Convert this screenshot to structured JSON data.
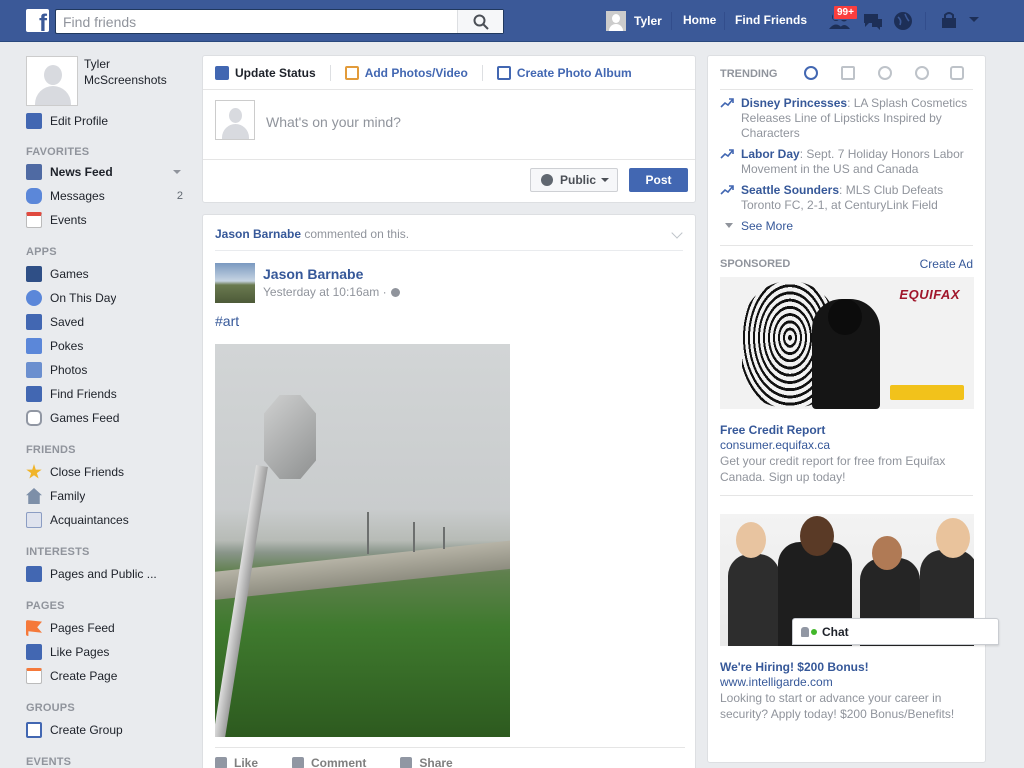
{
  "topbar": {
    "search_placeholder": "Find friends",
    "user_name": "Tyler",
    "home": "Home",
    "find_friends": "Find Friends",
    "friend_requests_badge": "99+",
    "brand_color": "#3b5998"
  },
  "sidebar": {
    "profile_name": "Tyler McScreenshots",
    "edit_profile": "Edit Profile",
    "sections": {
      "favorites": "FAVORITES",
      "apps": "APPS",
      "friends": "FRIENDS",
      "interests": "INTERESTS",
      "pages": "PAGES",
      "groups": "GROUPS",
      "events": "EVENTS"
    },
    "favorites": [
      {
        "label": "News Feed",
        "icon": "news-feed-icon",
        "count": ""
      },
      {
        "label": "Messages",
        "icon": "messages-icon",
        "count": "2"
      },
      {
        "label": "Events",
        "icon": "events-icon",
        "count": ""
      }
    ],
    "apps": [
      {
        "label": "Games",
        "icon": "games-icon"
      },
      {
        "label": "On This Day",
        "icon": "on-this-day-icon"
      },
      {
        "label": "Saved",
        "icon": "saved-icon"
      },
      {
        "label": "Pokes",
        "icon": "pokes-icon"
      },
      {
        "label": "Photos",
        "icon": "photos-icon"
      },
      {
        "label": "Find Friends",
        "icon": "find-friends-icon"
      },
      {
        "label": "Games Feed",
        "icon": "games-feed-icon"
      }
    ],
    "friends": [
      {
        "label": "Close Friends",
        "icon": "star-icon"
      },
      {
        "label": "Family",
        "icon": "family-icon"
      },
      {
        "label": "Acquaintances",
        "icon": "acquaintances-icon"
      }
    ],
    "interests": [
      {
        "label": "Pages and Public ...",
        "icon": "pages-public-icon"
      }
    ],
    "pages": [
      {
        "label": "Pages Feed",
        "icon": "flag-icon"
      },
      {
        "label": "Like Pages",
        "icon": "like-pages-icon"
      },
      {
        "label": "Create Page",
        "icon": "create-page-icon"
      }
    ],
    "groups": [
      {
        "label": "Create Group",
        "icon": "create-group-icon"
      }
    ]
  },
  "composer": {
    "tabs": [
      "Update Status",
      "Add Photos/Video",
      "Create Photo Album"
    ],
    "placeholder": "What's on your mind?",
    "privacy": "Public",
    "post_button": "Post"
  },
  "post": {
    "story_actor": "Jason Barnabe",
    "story_action": " commented on this.",
    "author": "Jason Barnabe",
    "time": "Yesterday at 10:16am ·",
    "text": "#art",
    "actions": [
      "Like",
      "Comment",
      "Share"
    ]
  },
  "trending": {
    "title": "TRENDING",
    "items": [
      {
        "topic": "Disney Princesses",
        "desc": ": LA Splash Cosmetics Releases Line of Lipsticks Inspired by Characters"
      },
      {
        "topic": "Labor Day",
        "desc": ": Sept. 7 Holiday Honors Labor Movement in the US and Canada"
      },
      {
        "topic": "Seattle Sounders",
        "desc": ": MLS Club Defeats Toronto FC, 2-1, at CenturyLink Field"
      }
    ],
    "see_more": "See More"
  },
  "sponsored": {
    "title": "SPONSORED",
    "create_ad": "Create Ad",
    "ads": [
      {
        "brand_text": "EQUIFAX",
        "title": "Free Credit Report",
        "url": "consumer.equifax.ca",
        "desc": "Get your credit report for free from Equifax Canada. Sign up today!"
      },
      {
        "title": "We're Hiring! $200 Bonus!",
        "url": "www.intelligarde.com",
        "desc": "Looking to start or advance your career in security? Apply today! $200 Bonus/Benefits!"
      }
    ]
  },
  "chat": {
    "label": "Chat"
  }
}
